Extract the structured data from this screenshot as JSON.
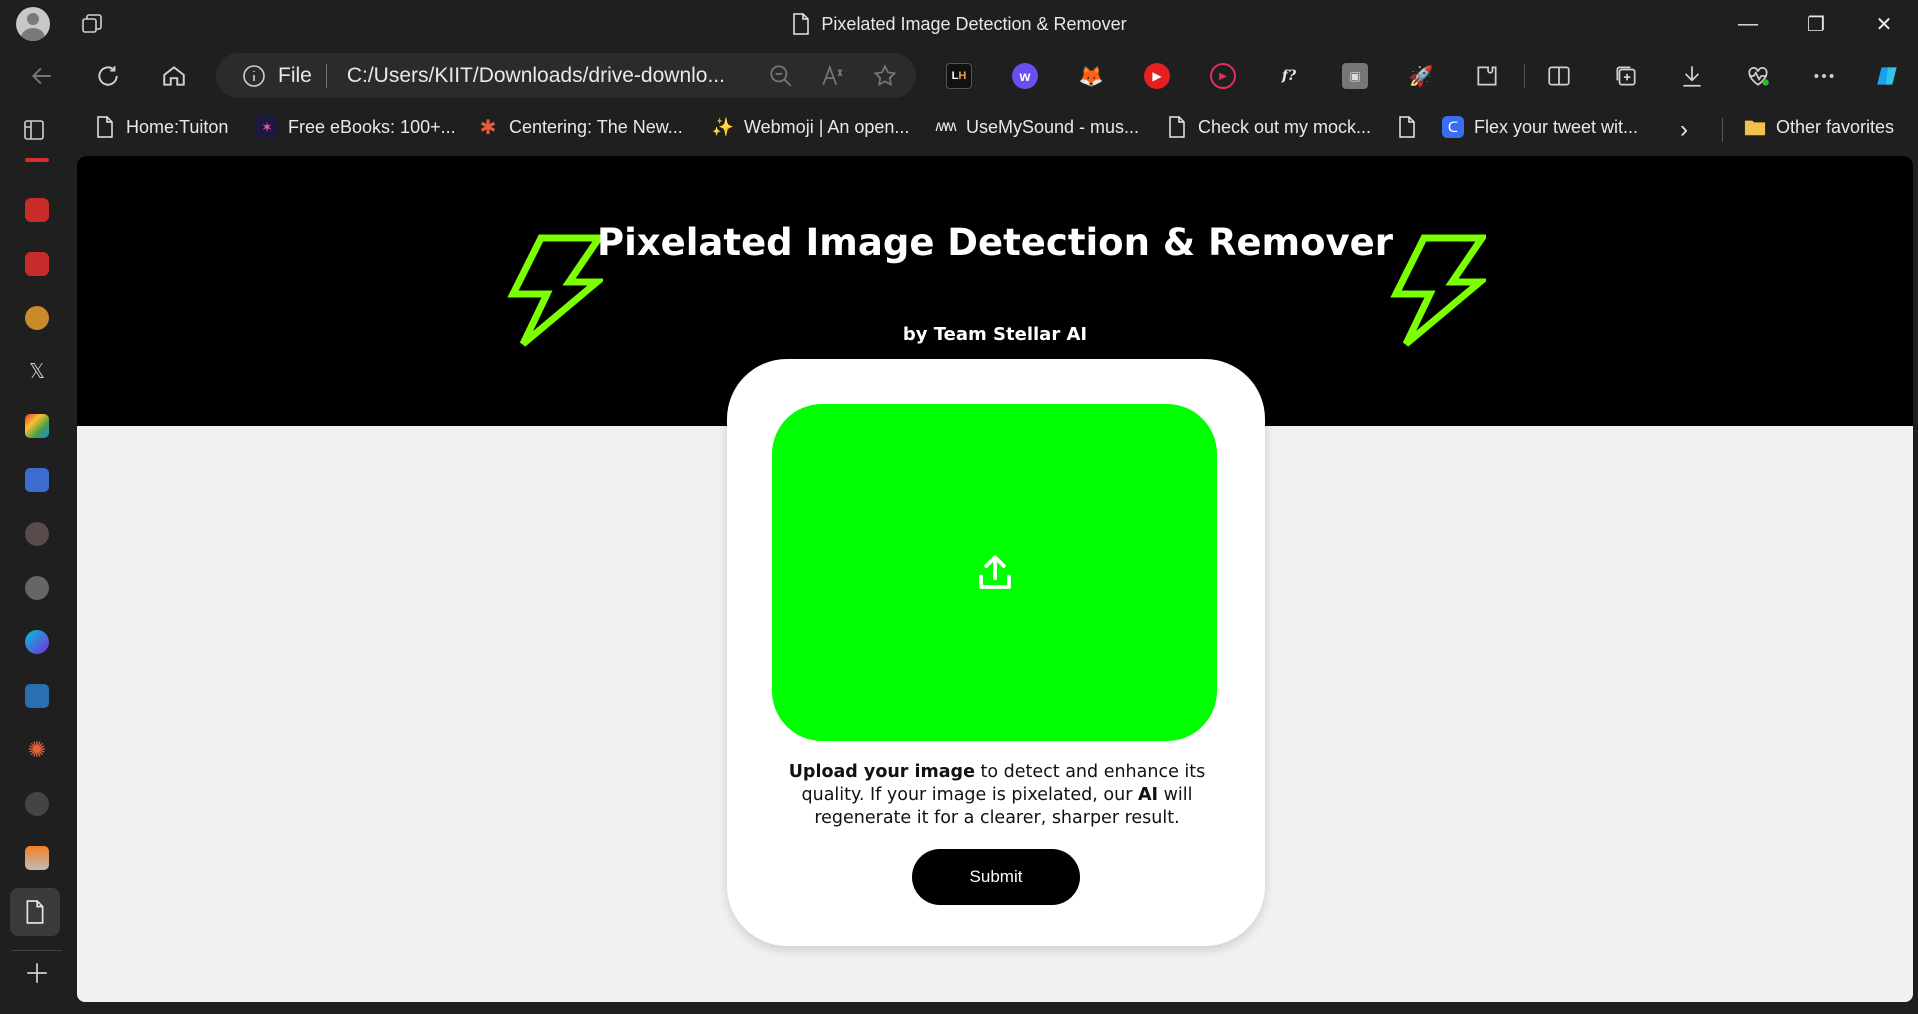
{
  "window": {
    "title": "Pixelated Image Detection & Remover",
    "controls": {
      "minimize": "—",
      "restore": "❐",
      "close": "✕"
    }
  },
  "toolbar": {
    "address_scheme": "File",
    "address_url": "C:/Users/KIIT/Downloads/drive-downlo...",
    "icons": [
      "back-icon",
      "refresh-icon",
      "home-icon",
      "info-icon",
      "zoom-out-icon",
      "read-aloud-icon",
      "favorite-star-icon",
      "split-screen-icon",
      "collections-icon",
      "downloads-icon",
      "health-icon",
      "more-icon",
      "copilot-icon"
    ]
  },
  "extensions": [
    {
      "name": "lighthouse-ext-icon",
      "label": "LH"
    },
    {
      "name": "webflow-ext-icon",
      "label": "w"
    },
    {
      "name": "metamask-ext-icon",
      "label": "🦊"
    },
    {
      "name": "youtube-ext-icon",
      "label": "▶"
    },
    {
      "name": "player-ext-icon",
      "label": "▶"
    },
    {
      "name": "font-ext-icon",
      "label": "f?"
    },
    {
      "name": "media-ext-icon",
      "label": "▣"
    },
    {
      "name": "rocket-ext-icon",
      "label": "🚀"
    },
    {
      "name": "extensions-icon",
      "label": "⚙"
    }
  ],
  "bookmarks": {
    "items": [
      "Home:Tuiton",
      "Free eBooks: 100+...",
      "Centering: The New...",
      "Webmoji | An open...",
      "UseMySound - mus...",
      "Check out my mock...",
      "",
      "Flex your tweet wit..."
    ],
    "more": "›",
    "other": "Other favorites"
  },
  "page": {
    "title": "Pixelated Image Detection & Remover",
    "byline": "by Team Stellar AI",
    "description": {
      "strong1": "Upload your image",
      "text1": " to detect and enhance its quality. If your image is pixelated, our ",
      "strong2": "AI",
      "text2": " will regenerate it for a clearer, sharper result."
    },
    "submit_label": "Submit",
    "accent": "#00ff00",
    "bolt_color": "#7cff00"
  }
}
